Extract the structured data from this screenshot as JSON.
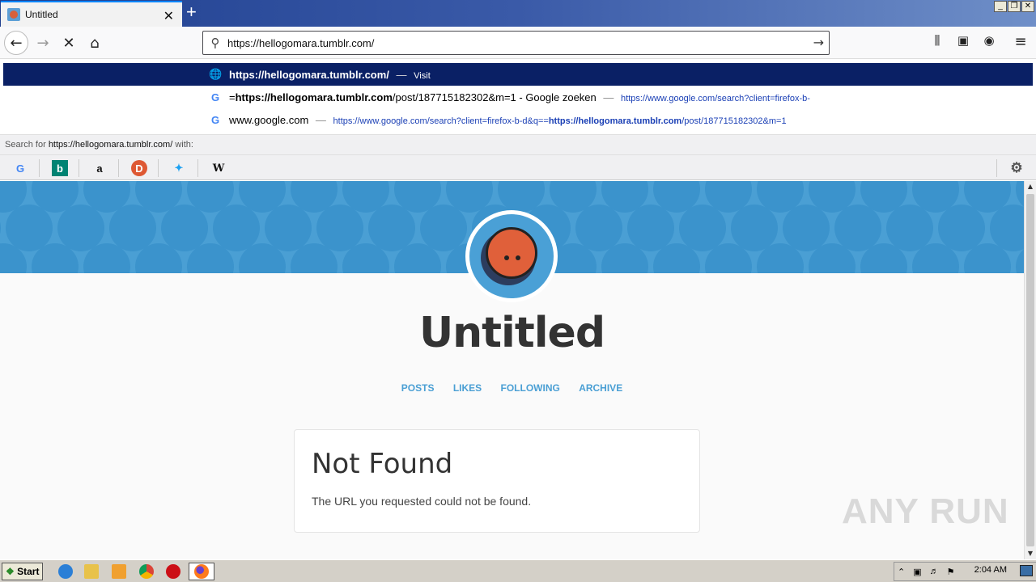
{
  "window": {
    "tab_title": "Untitled",
    "tab_close": "✕",
    "new_tab": "+",
    "controls": [
      "_",
      "❐",
      "✕"
    ]
  },
  "nav": {
    "back": "←",
    "forward": "→",
    "stop": "✕",
    "home": "⌂",
    "url": "https://hellogomara.tumblr.com/",
    "go": "→",
    "library": "⫼",
    "sidebar": "▣",
    "account": "◉",
    "menu": "≡"
  },
  "dropdown": [
    {
      "icon": "globe-icon",
      "main": "https://hellogomara.tumblr.com/",
      "sep": "—",
      "action": "Visit"
    },
    {
      "icon": "google-icon",
      "main_prefix": "=",
      "main_bold": "https://hellogomara.tumblr.com",
      "main_rest": "/post/187715182302&m=1 - Google zoeken",
      "sep": "—",
      "url": "https://www.google.com/search?client=firefox-b-"
    },
    {
      "icon": "google-icon",
      "main": "www.google.com",
      "sep": "—",
      "url_prefix": "https://www.google.com/search?client=firefox-b-d&q==",
      "url_bold": "https://hellogomara.tumblr.com",
      "url_rest": "/post/187715182302&m=1"
    }
  ],
  "search_for": {
    "prefix": "Search for",
    "query": "https://hellogomara.tumblr.com/",
    "suffix": "with:"
  },
  "engines": [
    "google",
    "bing",
    "amazon",
    "duckduckgo",
    "twitter",
    "wikipedia"
  ],
  "page": {
    "blog_title": "Untitled",
    "nav_links": [
      "POSTS",
      "LIKES",
      "FOLLOWING",
      "ARCHIVE"
    ],
    "card_title": "Not Found",
    "card_message": "The URL you requested could not be found.",
    "watermark": "ANY RUN"
  },
  "taskbar": {
    "start": "Start",
    "clock": "2:04 AM"
  },
  "colors": {
    "banner": "#4a9fd4",
    "accent_link": "#4a9fd4",
    "dropdown_selected": "#0a2065"
  }
}
